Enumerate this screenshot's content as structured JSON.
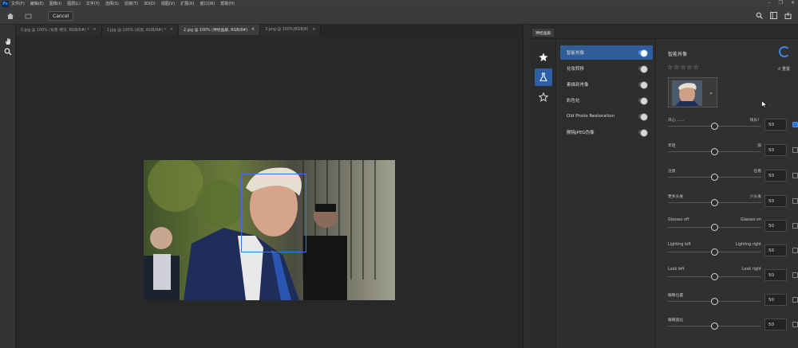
{
  "menubar": {
    "logo": "Ps",
    "items": [
      "文件(F)",
      "编辑(E)",
      "图像(I)",
      "图层(L)",
      "文字(Y)",
      "选择(S)",
      "滤镜(T)",
      "3D(D)",
      "视图(V)",
      "扩展(R)",
      "窗口(W)",
      "帮助(H)"
    ]
  },
  "optionsbar": {
    "cancel_label": "Cancel"
  },
  "tabs": [
    {
      "label": "0.jpg @ 100% (背景 拷贝, RGB/8#) *",
      "active": false
    },
    {
      "label": "1.jpg @ 100% (背景, RGB/8#) *",
      "active": false
    },
    {
      "label": "2.jpg @ 100% (神经画廊, RGB/8#)",
      "active": true
    },
    {
      "label": "3.png @ 100%(RGB/8)",
      "active": false
    }
  ],
  "panel": {
    "tab_label": "神经画廊",
    "filters": [
      {
        "label": "智能肖像",
        "active": true,
        "on": true
      },
      {
        "label": "化妆转移",
        "active": false,
        "on": false
      },
      {
        "label": "素描到肖像",
        "active": false,
        "on": false
      },
      {
        "label": "彩色化",
        "active": false,
        "on": false
      },
      {
        "label": "Old Photo Restoration",
        "active": false,
        "on": false
      },
      {
        "label": "删除JPEG伪像",
        "active": false,
        "on": false
      }
    ],
    "settings": {
      "title": "智能肖像",
      "stars": "☆☆☆☆☆",
      "reset_label": "重置",
      "sliders": [
        {
          "left": "开心 ......",
          "right": "快乐！",
          "value": "50",
          "checked": true
        },
        {
          "left": "年轻",
          "right": "旧",
          "value": "50",
          "checked": false
        },
        {
          "left": "注意",
          "right": "在看",
          "value": "50",
          "checked": false
        },
        {
          "left": "更多头发",
          "right": "少头发",
          "value": "50",
          "checked": false
        },
        {
          "left": "Glasses off",
          "right": "Glasses on",
          "value": "50",
          "checked": false
        },
        {
          "left": "Lighting left",
          "right": "Lighting right",
          "value": "50",
          "checked": false
        },
        {
          "left": "Look left",
          "right": "Look right",
          "value": "50",
          "checked": false
        },
        {
          "left": "眼睛位置",
          "right": "",
          "value": "50",
          "checked": false
        },
        {
          "left": "眼睛宽化",
          "right": "",
          "value": "50",
          "checked": false
        }
      ]
    }
  },
  "colors": {
    "accent": "#2f5d9a",
    "face_box": "#2f7fd6"
  }
}
